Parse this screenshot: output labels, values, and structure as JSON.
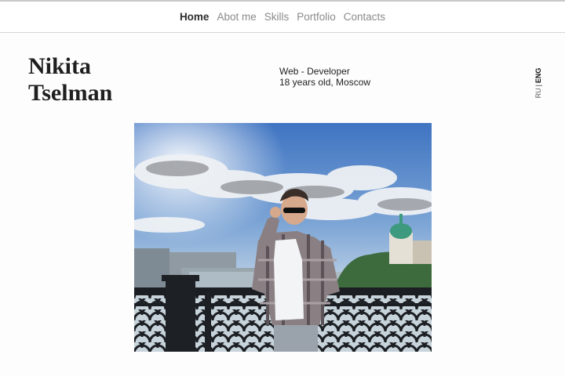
{
  "nav": {
    "items": [
      {
        "label": "Home",
        "active": true
      },
      {
        "label": "Abot me",
        "active": false
      },
      {
        "label": "Skills",
        "active": false
      },
      {
        "label": "Portfolio",
        "active": false
      },
      {
        "label": "Contacts",
        "active": false
      }
    ]
  },
  "profile": {
    "first_name": "Nikita",
    "last_name": "Tselman",
    "role": "Web - Developer",
    "details": "18 years old, Moscow"
  },
  "language": {
    "options": [
      "RU",
      "ENG"
    ],
    "separator": "|",
    "active": "ENG"
  },
  "colors": {
    "nav_active": "#2f2f2f",
    "nav_inactive": "#8a8a8a",
    "text": "#1f1f1f",
    "sky": "#6a92c4",
    "dome": "#3e9a7e"
  }
}
